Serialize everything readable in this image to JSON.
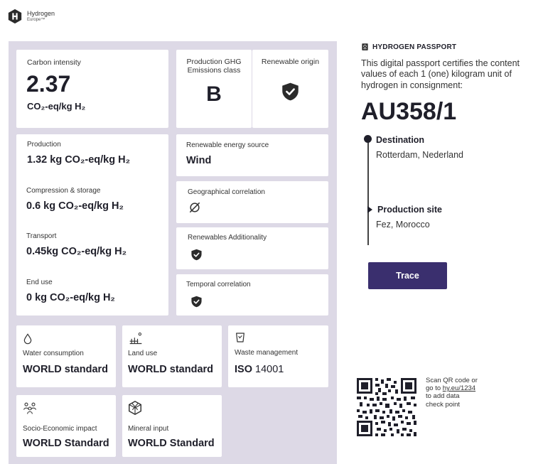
{
  "brand": {
    "name": "Hydrogen",
    "sub": "Europe™"
  },
  "carbon": {
    "label": "Carbon intensity",
    "value": "2.37",
    "unit": "CO₂-eq/kg H₂"
  },
  "ghg": {
    "label": "Production GHG Emissions class",
    "value": "B"
  },
  "renewable_origin": {
    "label": "Renewable origin"
  },
  "breakdown": [
    {
      "label": "Production",
      "value": "1.32 kg CO₂-eq/kg H₂"
    },
    {
      "label": "Compression & storage",
      "value": "0.6 kg CO₂-eq/kg H₂"
    },
    {
      "label": "Transport",
      "value": "0.45kg CO₂-eq/kg H₂"
    },
    {
      "label": "End use",
      "value": "0 kg CO₂-eq/kg H₂"
    }
  ],
  "energy_source": {
    "label": "Renewable energy source",
    "value": "Wind"
  },
  "geo": {
    "label": "Geographical correlation"
  },
  "additionality": {
    "label": "Renewables Additionality"
  },
  "temporal": {
    "label": "Temporal correlation"
  },
  "standards": [
    {
      "label": "Water consumption",
      "value": "WORLD standard",
      "icon": "water-drop-icon"
    },
    {
      "label": "Land use",
      "value": "WORLD standard",
      "icon": "land-use-icon"
    },
    {
      "label": "Waste management",
      "value_bold": "ISO",
      "value_rest": " 14001",
      "icon": "waste-bin-icon"
    },
    {
      "label": "Socio-Economic impact",
      "value": "WORLD Standard",
      "icon": "people-icon"
    },
    {
      "label": "Mineral input",
      "value": "WORLD Standard",
      "icon": "mineral-icon"
    }
  ],
  "passport": {
    "title": "HYDROGEN PASSPORT",
    "description": "This digital passport certifies the content values of each 1 (one) kilogram unit of hydrogen in consignment:",
    "id": "AU358/1"
  },
  "timeline": {
    "destination_label": "Destination",
    "destination_value": "Rotterdam, Nederland",
    "production_label": "Production site",
    "production_value": "Fez, Morocco"
  },
  "trace_button": "Trace",
  "qr": {
    "line1": "Scan QR code or",
    "line2_pre": "go to ",
    "link": "hy.eu/1234",
    "line3": "to add data",
    "line4": "check point"
  },
  "colors": {
    "panel": "#ddd9e6",
    "button": "#3a2f6e",
    "text": "#1f1f2a"
  }
}
